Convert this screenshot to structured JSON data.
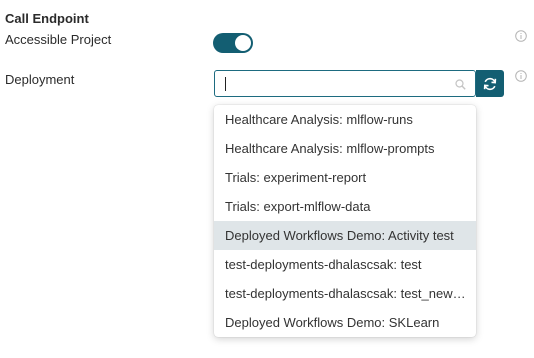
{
  "section": {
    "title": "Call Endpoint"
  },
  "accessible_project": {
    "label": "Accessible Project",
    "enabled": true
  },
  "deployment": {
    "label": "Deployment",
    "search": {
      "value": "",
      "placeholder": ""
    },
    "options": [
      "Healthcare Analysis: mlflow-runs",
      "Healthcare Analysis: mlflow-prompts",
      "Trials: experiment-report",
      "Trials: export-mlflow-data",
      "Deployed Workflows Demo: Activity test",
      "test-deployments-dhalascsak: test",
      "test-deployments-dhalascsak: test_new_deployment",
      "Deployed Workflows Demo: SKLearn"
    ],
    "highlighted_index": 4
  },
  "colors": {
    "accent": "#135e72",
    "highlight": "#dfe5e8"
  },
  "icons": {
    "info": "info-icon",
    "search": "search-icon",
    "refresh": "refresh-icon"
  }
}
